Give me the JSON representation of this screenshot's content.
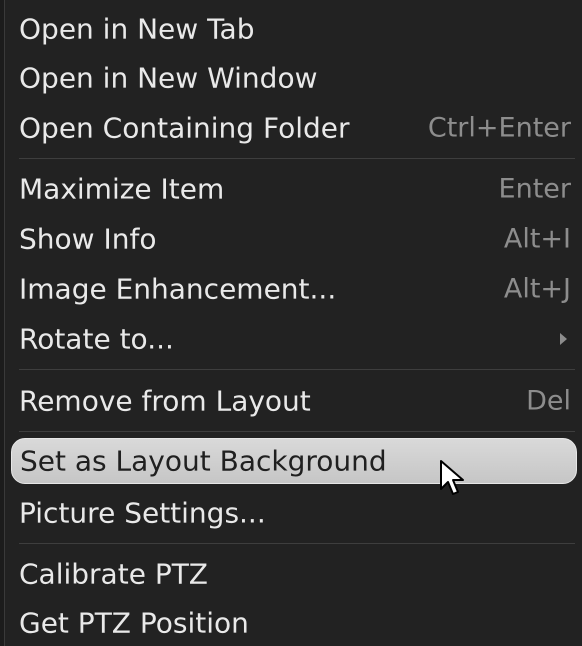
{
  "menu": {
    "items": [
      {
        "label": "Open in New Tab",
        "shortcut": ""
      },
      {
        "label": "Open in New Window",
        "shortcut": ""
      },
      {
        "label": "Open Containing Folder",
        "shortcut": "Ctrl+Enter"
      },
      {
        "label": "Maximize Item",
        "shortcut": "Enter"
      },
      {
        "label": "Show Info",
        "shortcut": "Alt+I"
      },
      {
        "label": "Image Enhancement...",
        "shortcut": "Alt+J"
      },
      {
        "label": "Rotate to...",
        "shortcut": ""
      },
      {
        "label": "Remove from Layout",
        "shortcut": "Del"
      },
      {
        "label": "Set as Layout Background",
        "shortcut": ""
      },
      {
        "label": "Picture Settings...",
        "shortcut": ""
      },
      {
        "label": "Calibrate PTZ",
        "shortcut": ""
      },
      {
        "label": "Get PTZ Position",
        "shortcut": ""
      }
    ],
    "highlighted_index": 8,
    "colors": {
      "menu_background": "#222222",
      "text": "#e9e9e9",
      "shortcut_text": "#8d8d8d",
      "highlight": "#d0d0d0"
    }
  },
  "icons": {
    "submenu": "chevron-right-icon",
    "pointer": "mouse-pointer-icon"
  }
}
